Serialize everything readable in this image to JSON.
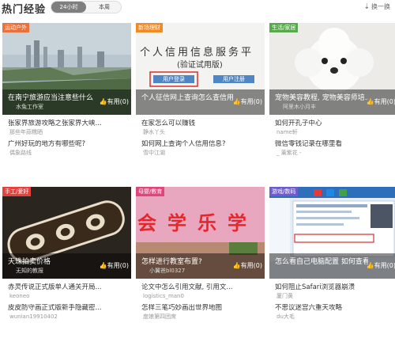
{
  "header": {
    "title": "热门经验",
    "tabs": [
      "24小时",
      "本周"
    ],
    "swap_label": "换一换"
  },
  "colors": {
    "accent_orange": "#e8713c",
    "tab_active": "#7f7f7f"
  },
  "cards": [
    {
      "badge": "运动户外",
      "featured": {
        "title": "在南宁旅游应当注意些什么",
        "author": "水兔工作室",
        "likes": "有用(0)"
      },
      "items": [
        {
          "title": "张家界旅游攻略之张家界大峡...",
          "author": "那些年蒜糯晒"
        },
        {
          "title": "广州好玩的地方有哪些呢?",
          "author": "偶象路线"
        }
      ]
    },
    {
      "badge": "新场理财",
      "image_text": {
        "line1": "个人信用信息服务平",
        "line2": "(验证试用版)",
        "btn_login": "用户登录",
        "btn_register": "用户注册"
      },
      "featured": {
        "title": "个人征信网上查询怎么查信用...",
        "author": "",
        "likes": "有用(0)"
      },
      "items": [
        {
          "title": "在家怎么可以赚钱",
          "author": "静水丫头"
        },
        {
          "title": "如何网上查询个人信用信息?",
          "author": "雪中江湖"
        }
      ]
    },
    {
      "badge": "生活/家居",
      "featured": {
        "title": "宠物美容教程, 宠物美容师培...",
        "author": "阿里木小月丰",
        "likes": "有用(0)"
      },
      "items": [
        {
          "title": "如何开孔子中心",
          "author": "name轩"
        },
        {
          "title": "微信零钱记录在哪里看",
          "author": "_ 薰紫花 -"
        }
      ]
    },
    {
      "badge": "手工/爱好",
      "featured": {
        "title": "天珠拍卖价格",
        "author": "无知的教报",
        "likes": "有用(0)"
      },
      "items": [
        {
          "title": "赤灵传说正式版单人通关开局...",
          "author": "keoneo"
        },
        {
          "title": "皮皮防守画正式版新手隐藏密...",
          "author": "wunian19910402"
        }
      ]
    },
    {
      "badge": "母婴/教育",
      "image_text": {
        "banner": "会学乐学"
      },
      "featured": {
        "title": "怎样进行教室布置?",
        "author": "小翼爸bl0327",
        "likes": "有用(0)"
      },
      "items": [
        {
          "title": "论文中怎么引用文献, 引用文...",
          "author": "logistics_man0"
        },
        {
          "title": "怎样三笔巧妙画出世界地图",
          "author": "度娘第四团席"
        }
      ]
    },
    {
      "badge": "游戏/数码",
      "featured": {
        "title": "怎么看自己电脑配置 如何查看...",
        "author": "",
        "likes": "有用(0)"
      },
      "items": [
        {
          "title": "如何阻止Safari浏览器崩溃",
          "author": "厦门黄"
        },
        {
          "title": "不思议迷宫六重天攻略",
          "author": "du大毛"
        }
      ]
    }
  ]
}
